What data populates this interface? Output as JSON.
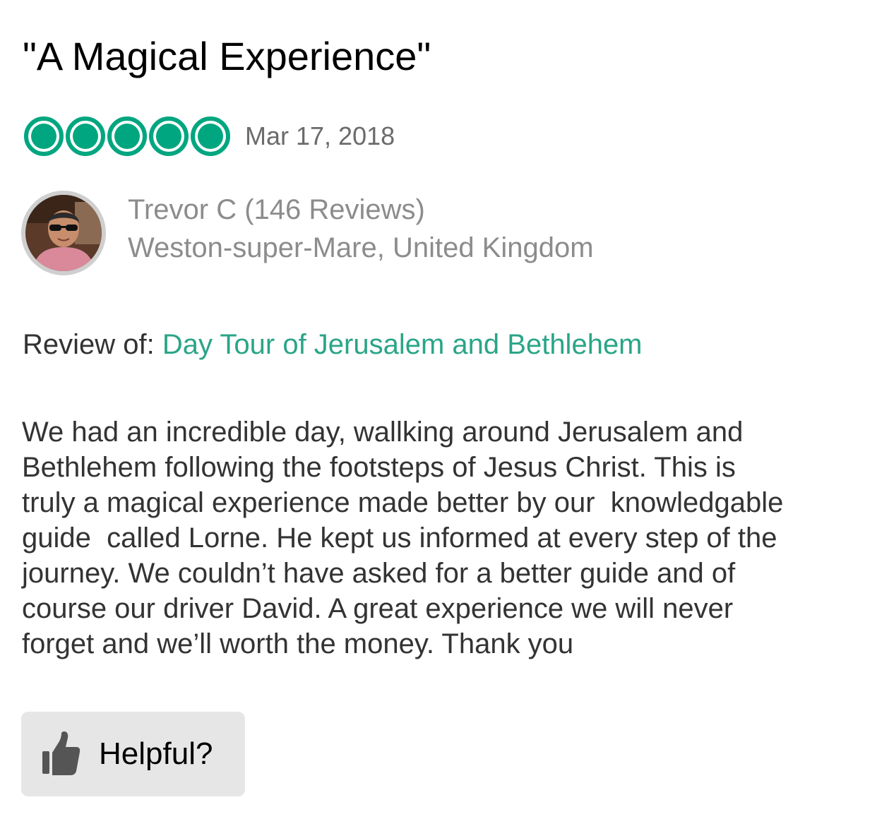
{
  "review": {
    "title": "\"A Magical Experience\"",
    "rating": {
      "value": 5,
      "max": 5,
      "color": "#00a680"
    },
    "date": "Mar 17, 2018",
    "reviewer": {
      "name_line": "Trevor C (146 Reviews)",
      "location": "Weston-super-Mare, United Kingdom"
    },
    "review_of": {
      "label": "Review of:",
      "link_text": "Day Tour of Jerusalem and Bethlehem",
      "link_color": "#2aa587"
    },
    "body": "We had an incredible day, wallking around Jerusalem and\nBethlehem following the footsteps of Jesus Christ. This is\ntruly a magical experience made better by our  knowledgable\nguide  called Lorne. He kept us informed at every step of the\njourney. We couldn’t have asked for a better guide and of\ncourse our driver David. A great experience we will never\nforget and we’ll worth the money. Thank you",
    "helpful": {
      "label": "Helpful?",
      "icon": "thumbs-up-icon"
    }
  }
}
